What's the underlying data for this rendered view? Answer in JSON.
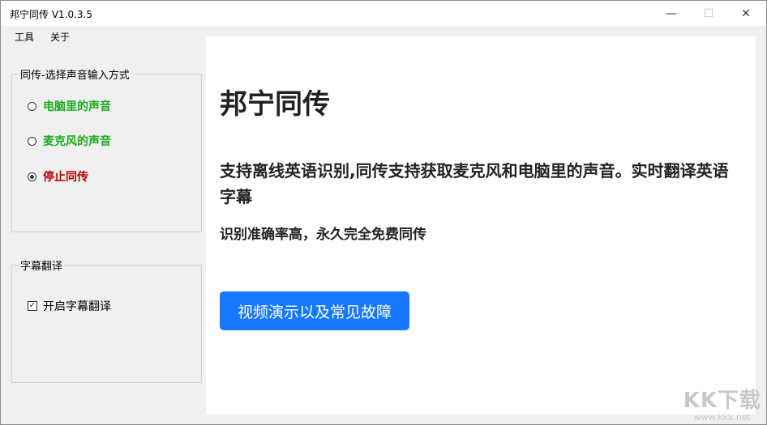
{
  "window": {
    "title": "邦宁同传 V1.0.3.5",
    "minimize_glyph": "—",
    "maximize_glyph": "☐",
    "close_glyph": "✕"
  },
  "menu": {
    "items": [
      "工具",
      "关于"
    ]
  },
  "input_group": {
    "legend": "同传-选择声音输入方式",
    "options": [
      {
        "label": "电脑里的声音",
        "color": "#1aaa1a",
        "checked": false
      },
      {
        "label": "麦克风的声音",
        "color": "#1aaa1a",
        "checked": false
      },
      {
        "label": "停止同传",
        "color": "#b00000",
        "checked": true
      }
    ]
  },
  "subtitle_group": {
    "legend": "字幕翻译",
    "checkbox": {
      "label": "开启字幕翻译",
      "checked": true,
      "check_glyph": "✓"
    }
  },
  "content": {
    "heading": "邦宁同传",
    "description": "支持离线英语识别,同传支持获取麦克风和电脑里的声音。实时翻译英语字幕",
    "subtext": "识别准确率高，永久完全免费同传",
    "video_button": "视频演示以及常见故障",
    "button_color": "#1677ff"
  },
  "watermark": {
    "main": "KK下载",
    "sub": "www.kkx.net"
  }
}
